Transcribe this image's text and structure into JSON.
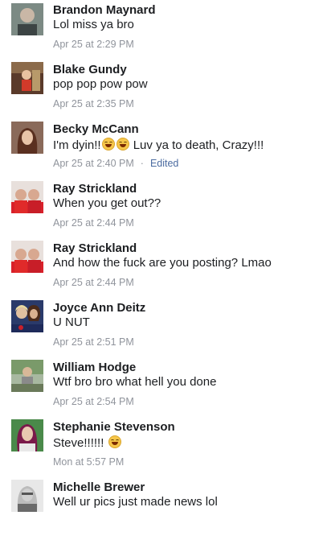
{
  "comments": [
    {
      "name": "Brandon Maynard",
      "text": "Lol miss ya bro",
      "time": "Apr 25 at 2:29 PM"
    },
    {
      "name": "Blake Gundy",
      "text": "pop pop pow pow",
      "time": "Apr 25 at 2:35 PM"
    },
    {
      "name": "Becky McCann",
      "text_pre": "I'm dyin!!",
      "text_post": " Luv ya to death, Crazy!!!",
      "time": "Apr 25 at 2:40 PM",
      "edited": "Edited"
    },
    {
      "name": "Ray Strickland",
      "text": "When you get out??",
      "time": "Apr 25 at 2:44 PM"
    },
    {
      "name": "Ray Strickland",
      "text": "And how the fuck are you posting? Lmao",
      "time": "Apr 25 at 2:44 PM"
    },
    {
      "name": "Joyce Ann Deitz",
      "text": "U NUT",
      "time": "Apr 25 at 2:51 PM"
    },
    {
      "name": "William Hodge",
      "text": "Wtf bro bro what hell you done",
      "time": "Apr 25 at 2:54 PM"
    },
    {
      "name": "Stephanie Stevenson",
      "text_pre": "Steve!!!!!! ",
      "time": "Mon at 5:57 PM"
    },
    {
      "name": "Michelle Brewer",
      "text": "Well ur pics just made news lol",
      "time": ""
    }
  ]
}
